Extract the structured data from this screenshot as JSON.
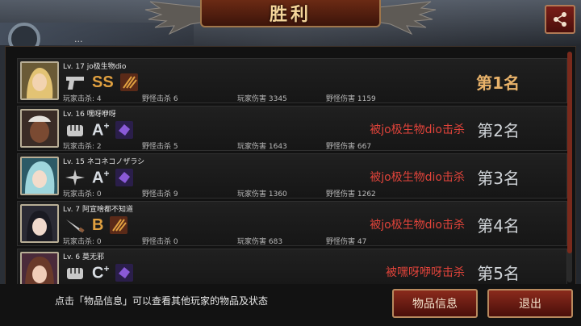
{
  "header": {
    "title": "胜利",
    "hud_text": "..."
  },
  "players": [
    {
      "level": "Lv. 17",
      "name": "jo极生物dio",
      "weapon_icon": "pistol-icon",
      "grade": "SS",
      "grade_plus": "",
      "item_icon": "bullets-icon",
      "player_kills_label": "玩家击杀: 4",
      "monster_kills_label": "野怪击杀 6",
      "player_damage_label": "玩家伤害 3345",
      "monster_damage_label": "野怪伤害 1159",
      "killed_by": "",
      "rank": "第1名"
    },
    {
      "level": "Lv. 16",
      "name": "嘿呀咿呀",
      "weapon_icon": "fist-icon",
      "grade": "A",
      "grade_plus": "+",
      "item_icon": "purple-gem-icon",
      "player_kills_label": "玩家击杀: 2",
      "monster_kills_label": "野怪击杀 5",
      "player_damage_label": "玩家伤害 1643",
      "monster_damage_label": "野怪伤害 667",
      "killed_by": "被jo极生物dio击杀",
      "rank": "第2名"
    },
    {
      "level": "Lv. 15",
      "name": "ネコネコノザラシ",
      "weapon_icon": "shuriken-icon",
      "grade": "A",
      "grade_plus": "+",
      "item_icon": "purple-gem-icon",
      "player_kills_label": "玩家击杀: 0",
      "monster_kills_label": "野怪击杀 9",
      "player_damage_label": "玩家伤害 1360",
      "monster_damage_label": "野怪伤害 1262",
      "killed_by": "被jo极生物dio击杀",
      "rank": "第3名"
    },
    {
      "level": "Lv. 7",
      "name": "阿宣啥都不知道",
      "weapon_icon": "knife-icon",
      "grade": "B",
      "grade_plus": "",
      "item_icon": "bullets-icon",
      "player_kills_label": "玩家击杀: 0",
      "monster_kills_label": "野怪击杀 0",
      "player_damage_label": "玩家伤害 683",
      "monster_damage_label": "野怪伤害 47",
      "killed_by": "被jo极生物dio击杀",
      "rank": "第4名"
    },
    {
      "level": "Lv. 6",
      "name": "莫无邪",
      "weapon_icon": "fist-icon",
      "grade": "C",
      "grade_plus": "+",
      "item_icon": "purple-gem-icon",
      "player_kills_label": "",
      "monster_kills_label": "",
      "player_damage_label": "",
      "monster_damage_label": "",
      "killed_by": "被嘿呀咿呀击杀",
      "rank": "第5名"
    }
  ],
  "footer": {
    "hint": "点击「物品信息」可以查看其他玩家的物品及状态",
    "item_info_button": "物品信息",
    "exit_button": "退出"
  },
  "colors": {
    "accent_red": "#e0433a",
    "rank_gold": "#e8b26a",
    "grade_ss": "#e0a040",
    "grade_a": "#d8dde3",
    "grade_b": "#e0a040",
    "grade_c": "#d8dde3"
  }
}
